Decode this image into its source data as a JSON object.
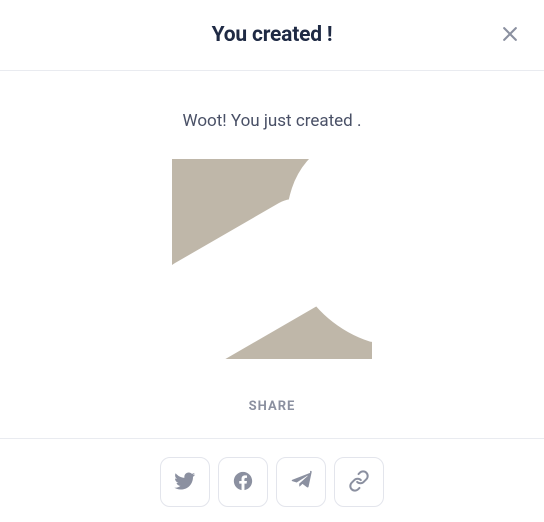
{
  "header": {
    "title": "You created        !"
  },
  "body": {
    "subtitle": "Woot! You just created       .",
    "share_label": "SHARE"
  }
}
